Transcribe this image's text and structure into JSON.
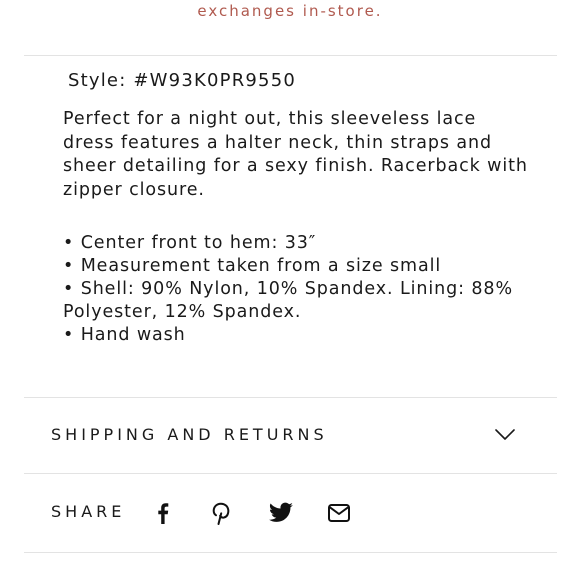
{
  "top_note": "exchanges in-store.",
  "product": {
    "style_line": "Style: #W93K0PR9550",
    "description": "Perfect for a night out, this sleeveless lace dress features a halter neck, thin straps and sheer detailing for a sexy finish. Racerback with zipper closure.",
    "details": [
      "Center front to hem: 33″",
      "Measurement taken from a size small",
      "Shell: 90% Nylon, 10% Spandex. Lining: 88% Polyester, 12% Spandex.",
      "Hand wash"
    ]
  },
  "shipping": {
    "label": "SHIPPING AND RETURNS",
    "icon": "chevron-down-icon",
    "expanded": false
  },
  "share": {
    "label": "SHARE",
    "icons": [
      "facebook-icon",
      "pinterest-icon",
      "twitter-icon",
      "email-icon"
    ]
  },
  "colors": {
    "accent": "#b05a4f",
    "text": "#1a1a1a",
    "divider": "#e3e3e3"
  }
}
